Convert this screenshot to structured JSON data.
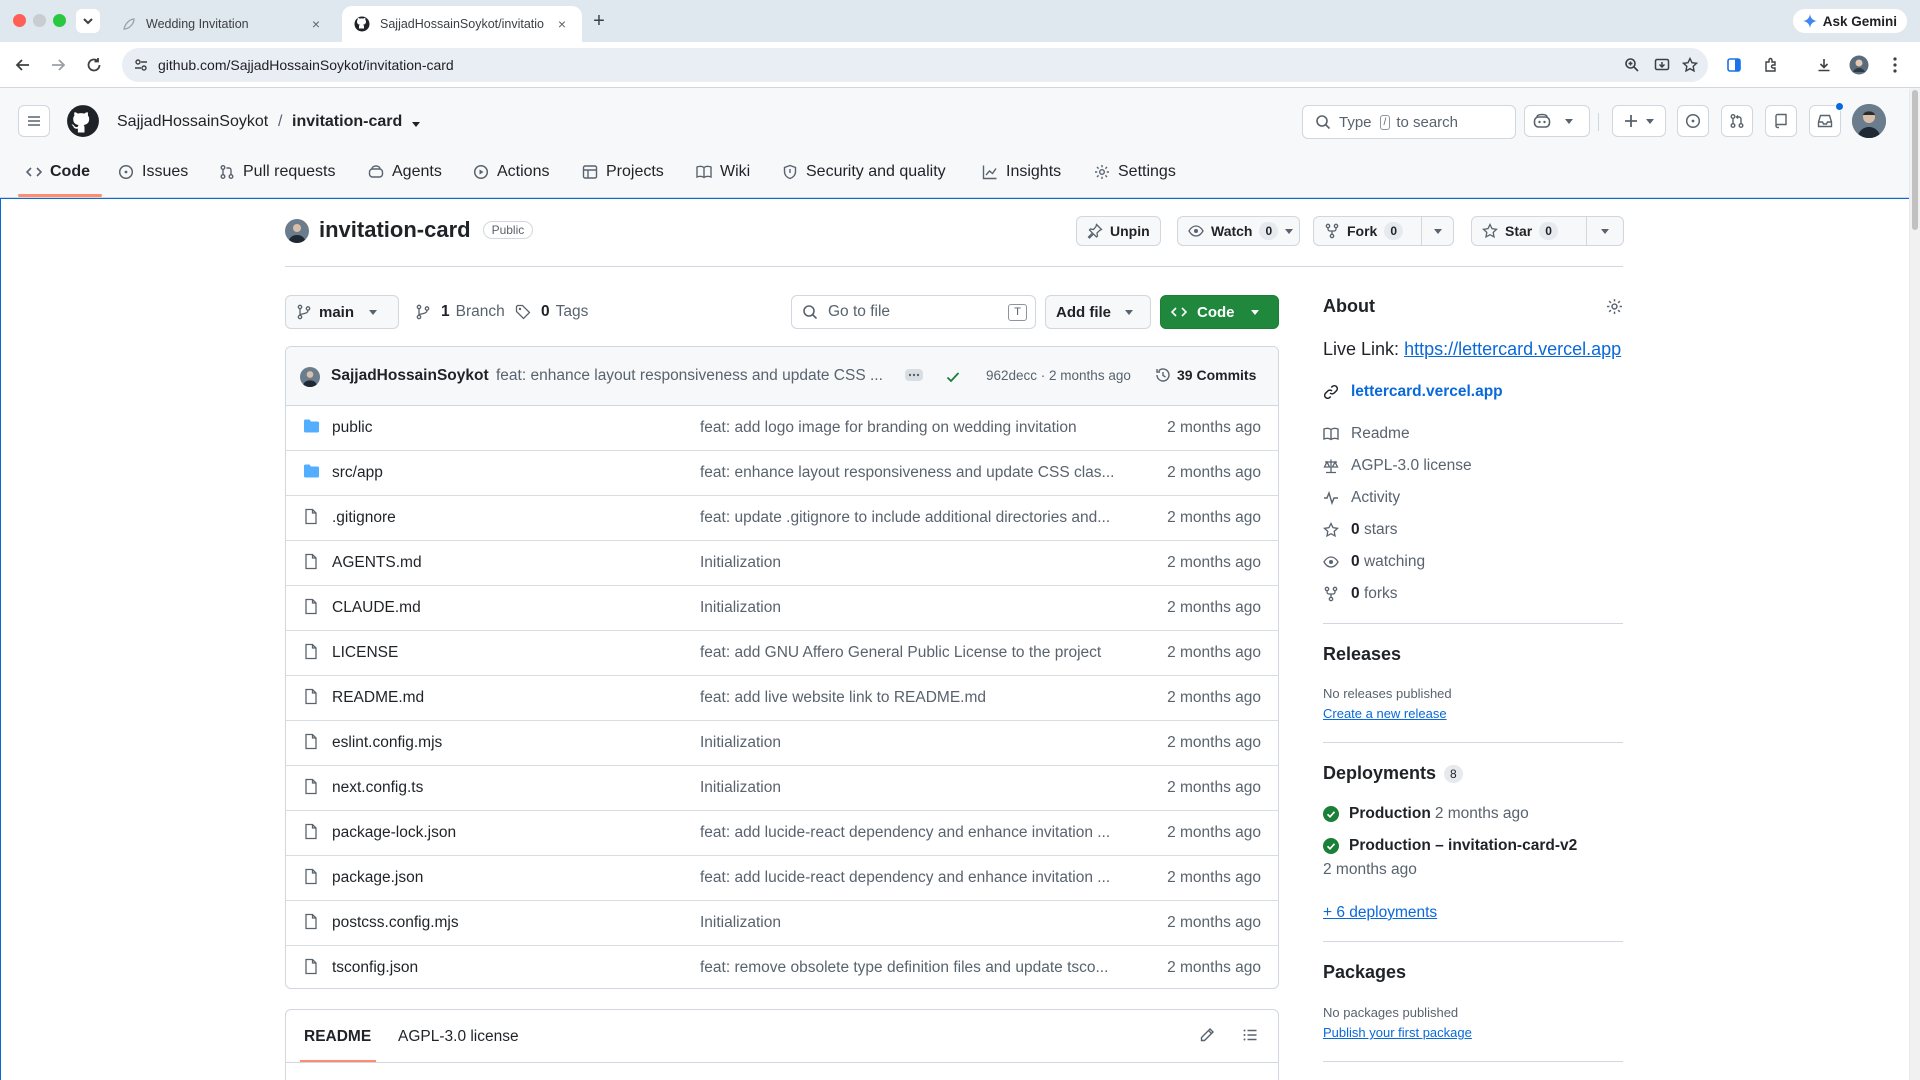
{
  "browser": {
    "tabs": [
      {
        "title": "Wedding Invitation"
      },
      {
        "title": "SajjadHossainSoykot/invitatio"
      }
    ],
    "url": "github.com/SajjadHossainSoykot/invitation-card",
    "ask_gemini": "Ask Gemini"
  },
  "header": {
    "owner": "SajjadHossainSoykot",
    "separator": "/",
    "repo": "invitation-card",
    "search_prefix": "Type",
    "search_key": "/",
    "search_suffix": "to search"
  },
  "nav": {
    "tabs": [
      "Code",
      "Issues",
      "Pull requests",
      "Agents",
      "Actions",
      "Projects",
      "Wiki",
      "Security and quality",
      "Insights",
      "Settings"
    ]
  },
  "repo": {
    "name": "invitation-card",
    "visibility": "Public",
    "unpin": "Unpin",
    "watch": "Watch",
    "watch_count": "0",
    "fork": "Fork",
    "fork_count": "0",
    "star": "Star",
    "star_count": "0"
  },
  "toolbar": {
    "branch": "main",
    "branches_count": "1",
    "branches_label": "Branch",
    "tags_count": "0",
    "tags_label": "Tags",
    "goto_placeholder": "Go to file",
    "goto_key": "T",
    "add_file": "Add file",
    "code": "Code"
  },
  "commit": {
    "author": "SajjadHossainSoykot",
    "message": "feat: enhance layout responsiveness and update CSS ...",
    "hash_age": "962decc · 2 months ago",
    "commits": "39 Commits"
  },
  "files": [
    {
      "name": "public",
      "type": "folder",
      "message": "feat: add logo image for branding on wedding invitation",
      "age": "2 months ago"
    },
    {
      "name": "src/app",
      "type": "folder",
      "message": "feat: enhance layout responsiveness and update CSS clas...",
      "age": "2 months ago"
    },
    {
      "name": ".gitignore",
      "type": "file",
      "message": "feat: update .gitignore to include additional directories and...",
      "age": "2 months ago"
    },
    {
      "name": "AGENTS.md",
      "type": "file",
      "message": "Initialization",
      "age": "2 months ago"
    },
    {
      "name": "CLAUDE.md",
      "type": "file",
      "message": "Initialization",
      "age": "2 months ago"
    },
    {
      "name": "LICENSE",
      "type": "file",
      "message": "feat: add GNU Affero General Public License to the project",
      "age": "2 months ago"
    },
    {
      "name": "README.md",
      "type": "file",
      "message": "feat: add live website link to README.md",
      "age": "2 months ago"
    },
    {
      "name": "eslint.config.mjs",
      "type": "file",
      "message": "Initialization",
      "age": "2 months ago"
    },
    {
      "name": "next.config.ts",
      "type": "file",
      "message": "Initialization",
      "age": "2 months ago"
    },
    {
      "name": "package-lock.json",
      "type": "file",
      "message": "feat: add lucide-react dependency and enhance invitation ...",
      "age": "2 months ago"
    },
    {
      "name": "package.json",
      "type": "file",
      "message": "feat: add lucide-react dependency and enhance invitation ...",
      "age": "2 months ago"
    },
    {
      "name": "postcss.config.mjs",
      "type": "file",
      "message": "Initialization",
      "age": "2 months ago"
    },
    {
      "name": "tsconfig.json",
      "type": "file",
      "message": "feat: remove obsolete type definition files and update tsco...",
      "age": "2 months ago"
    }
  ],
  "readme_tabs": [
    "README",
    "AGPL-3.0 license"
  ],
  "about": {
    "title": "About",
    "live_label": "Live Link:",
    "live_url": "https://lettercard.vercel.app",
    "website": "lettercard.vercel.app",
    "readme": "Readme",
    "license": "AGPL-3.0 license",
    "activity": "Activity",
    "stars_count": "0",
    "stars_label": "stars",
    "watching_count": "0",
    "watching_label": "watching",
    "forks_count": "0",
    "forks_label": "forks"
  },
  "releases": {
    "title": "Releases",
    "none": "No releases published",
    "create": "Create a new release"
  },
  "deployments": {
    "title": "Deployments",
    "count": "8",
    "items": [
      {
        "name": "Production",
        "age": "2 months ago"
      },
      {
        "name": "Production – invitation-card-v2",
        "age": "2 months ago"
      }
    ],
    "more": "+ 6 deployments"
  },
  "packages": {
    "title": "Packages",
    "none": "No packages published",
    "publish": "Publish your first package"
  },
  "colors": {
    "accent": "#0969da",
    "primary_button": "#1f883d",
    "success": "#1a7f37",
    "folder": "#54aeff",
    "tab_underline": "#fd8c73"
  }
}
